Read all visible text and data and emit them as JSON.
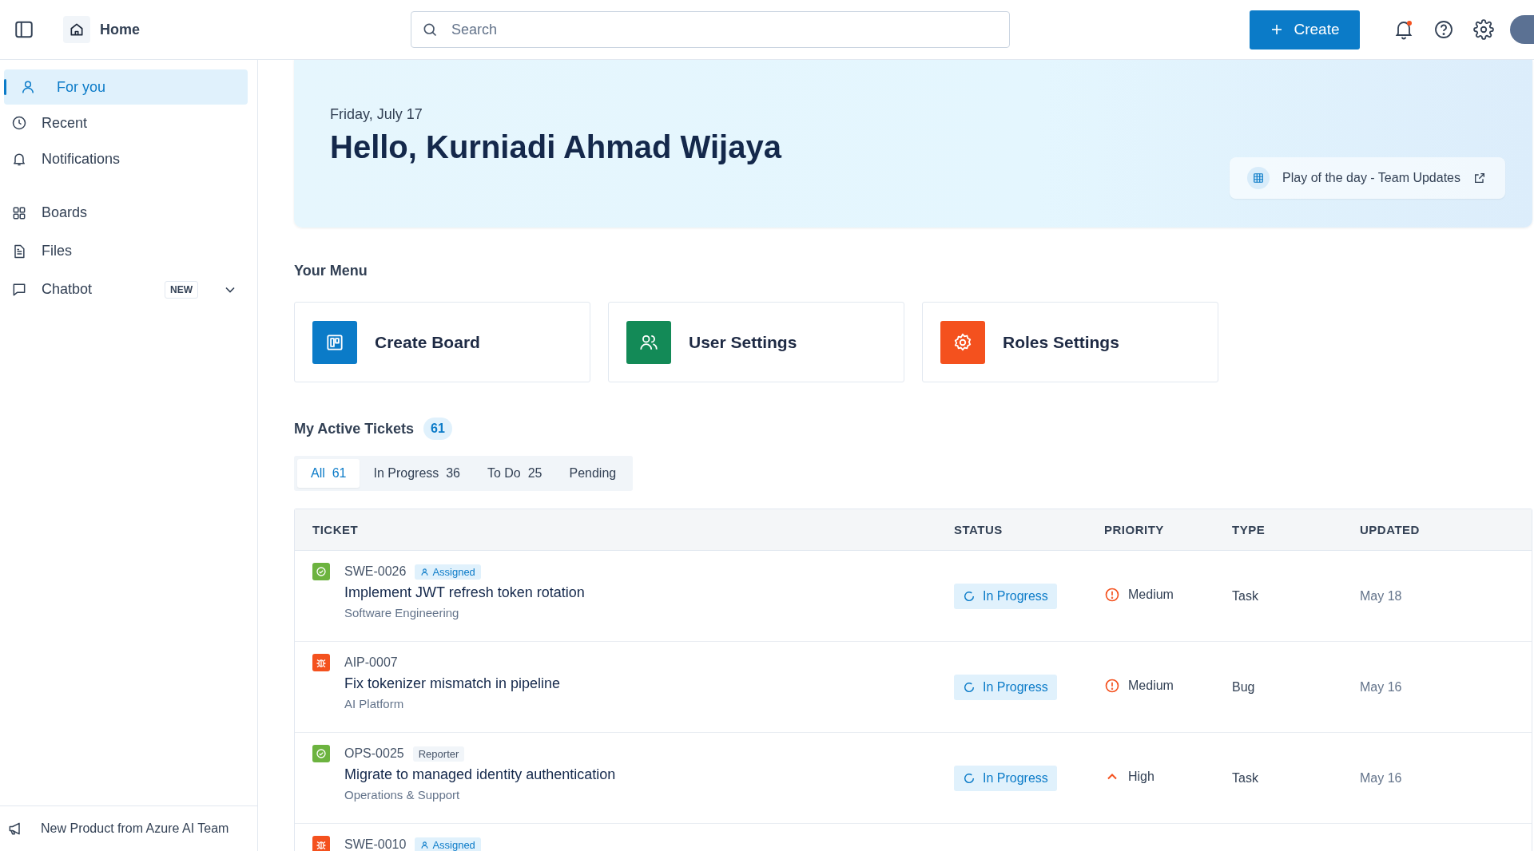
{
  "header": {
    "title": "Home",
    "search": {
      "placeholder": "Search"
    },
    "create_label": "Create",
    "notifications": {
      "unread": true
    }
  },
  "sidebar": {
    "sections": [
      [
        {
          "label": "For you",
          "selected": true
        },
        {
          "label": "Recent",
          "selected": false
        },
        {
          "label": "Notifications",
          "selected": false
        }
      ],
      [
        {
          "label": "Boards",
          "selected": false
        },
        {
          "label": "Files",
          "selected": false
        },
        {
          "label": "Chatbot",
          "selected": false,
          "badge": "NEW",
          "expandable": true
        }
      ]
    ],
    "footer": "New Product from Azure AI Team"
  },
  "hero": {
    "date": "Friday, July 17",
    "greeting": "Hello, Kurniadi Ahmad Wijaya",
    "link": "Play of the day - Team Updates"
  },
  "menu": {
    "title": "Your Menu",
    "cards": [
      {
        "label": "Create Board",
        "color": "#0b7bc8"
      },
      {
        "label": "User Settings",
        "color": "#138a57"
      },
      {
        "label": "Roles Settings",
        "color": "#f4511e"
      }
    ]
  },
  "tickets": {
    "title": "My Active Tickets",
    "count": "61",
    "tabs": [
      {
        "label": "All",
        "count": "61",
        "selected": true
      },
      {
        "label": "In Progress",
        "count": "36",
        "selected": false
      },
      {
        "label": "To Do",
        "count": "25",
        "selected": false
      },
      {
        "label": "Pending",
        "selected": false
      }
    ],
    "columns": [
      "TICKET",
      "STATUS",
      "PRIORITY",
      "TYPE",
      "UPDATED"
    ],
    "rows": [
      {
        "kind": "task",
        "id": "SWE-0026",
        "tag": {
          "label": "Assigned",
          "kind": "assigned"
        },
        "title": "Implement JWT refresh token rotation",
        "project": "Software Engineering",
        "status": "In Progress",
        "priority": {
          "label": "Medium",
          "kind": "medium"
        },
        "type": "Task",
        "updated": "May 18"
      },
      {
        "kind": "bug",
        "id": "AIP-0007",
        "title": "Fix tokenizer mismatch in pipeline",
        "project": "AI Platform",
        "status": "In Progress",
        "priority": {
          "label": "Medium",
          "kind": "medium"
        },
        "type": "Bug",
        "updated": "May 16"
      },
      {
        "kind": "task",
        "id": "OPS-0025",
        "tag": {
          "label": "Reporter",
          "kind": "reporter"
        },
        "title": "Migrate to managed identity authentication",
        "project": "Operations & Support",
        "status": "In Progress",
        "priority": {
          "label": "High",
          "kind": "high"
        },
        "type": "Task",
        "updated": "May 16"
      },
      {
        "kind": "bug",
        "id": "SWE-0010",
        "tag": {
          "label": "Assigned",
          "kind": "assigned"
        }
      }
    ]
  }
}
